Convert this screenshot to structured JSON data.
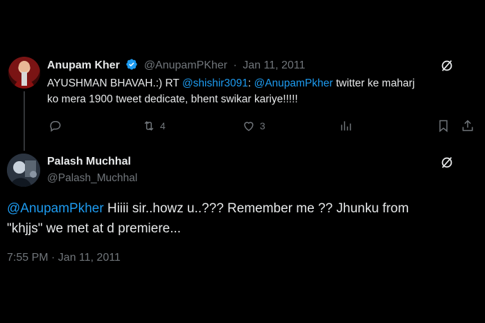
{
  "quoted_tweet": {
    "author_name": "Anupam Kher",
    "handle": "@AnupamPKher",
    "separator": "·",
    "date": "Jan 11, 2011",
    "text_prefix": "AYUSHMAN BHAVAH.:) RT ",
    "mention_1": "@shishir3091",
    "text_mid": ": ",
    "mention_2": "@AnupamPkher",
    "text_line1_end": " twitter ke maharj",
    "text_line2": "ko mera 1900 tweet dedicate, bhent swikar kariye!!!!!",
    "retweets": "4",
    "likes": "3"
  },
  "main_tweet": {
    "author_name": "Palash Muchhal",
    "handle": "@Palash_Muchhal",
    "mention": "@AnupamPkher",
    "text_line1": " Hiiii sir..howz u..??? Remember me ?? Jhunku from",
    "text_line2": "\"khjjs\" we met at d premiere...",
    "timestamp": "7:55 PM · Jan 11, 2011"
  },
  "colors": {
    "background": "#000000",
    "text": "#e7e9ea",
    "muted": "#71767b",
    "link": "#1d9bf0",
    "verified": "#1d9bf0"
  },
  "icons": [
    "verified-badge-icon",
    "grok-icon",
    "reply-icon",
    "retweet-icon",
    "like-icon",
    "views-icon",
    "bookmark-icon",
    "share-icon"
  ]
}
